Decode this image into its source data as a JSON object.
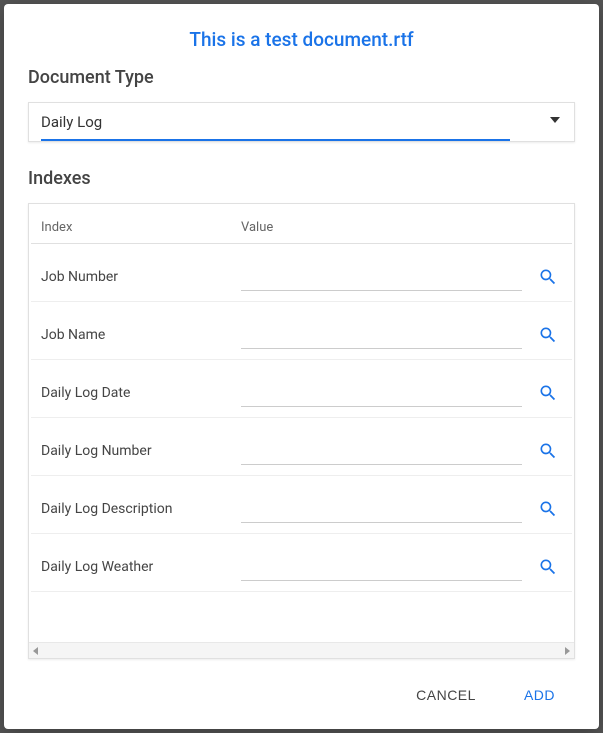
{
  "title": "This is a test document.rtf",
  "document_type": {
    "label": "Document Type",
    "selected": "Daily Log"
  },
  "indexes": {
    "label": "Indexes",
    "columns": {
      "index": "Index",
      "value": "Value"
    },
    "rows": [
      {
        "label": "Job Number",
        "value": ""
      },
      {
        "label": "Job Name",
        "value": ""
      },
      {
        "label": "Daily Log Date",
        "value": ""
      },
      {
        "label": "Daily Log Number",
        "value": ""
      },
      {
        "label": "Daily Log Description",
        "value": ""
      },
      {
        "label": "Daily Log Weather",
        "value": ""
      }
    ]
  },
  "actions": {
    "cancel": "CANCEL",
    "add": "ADD"
  }
}
